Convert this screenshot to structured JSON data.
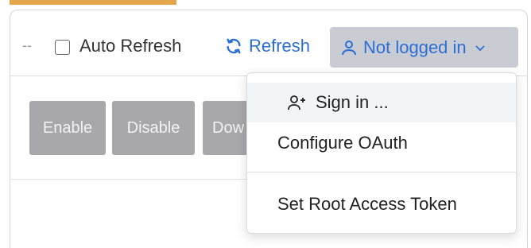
{
  "toolbar": {
    "dash": "--",
    "auto_refresh_label": "Auto Refresh",
    "auto_refresh_checked": false,
    "refresh_label": "Refresh",
    "login_label": "Not logged in"
  },
  "actions": {
    "enable_label": "Enable",
    "disable_label": "Disable",
    "download_label": "Dow"
  },
  "login_menu": {
    "items": [
      {
        "label": "Sign in ...",
        "icon": "user-plus-icon",
        "highlighted": true
      },
      {
        "label": "Configure OAuth"
      },
      {
        "label": "Set Root Access Token"
      }
    ]
  },
  "colors": {
    "accent_top": "#e3a64a",
    "link_blue": "#2b6fd6",
    "login_bg": "#c9ccd3",
    "disabled_button": "#a8a8aa"
  }
}
